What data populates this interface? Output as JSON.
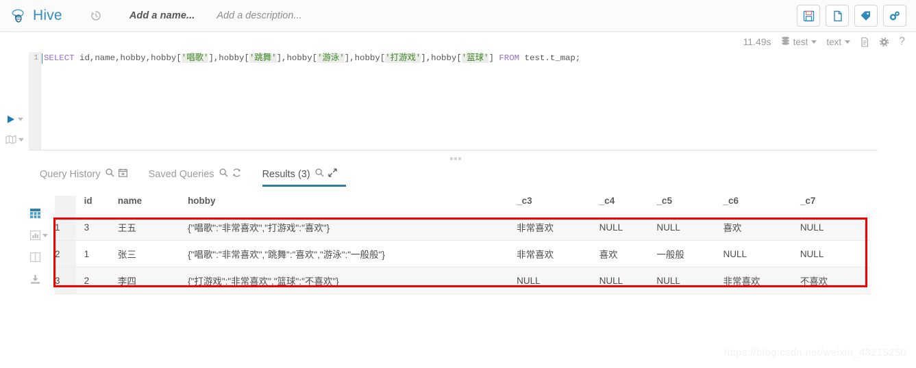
{
  "app": {
    "brand": "Hive",
    "logo_icon": "hive-bee-logo",
    "history_icon": "history-clock-icon",
    "name_placeholder": "Add a name...",
    "description_placeholder": "Add a description...",
    "actions": [
      {
        "name": "save-button",
        "icon": "floppy-disk-icon"
      },
      {
        "name": "new-query-button",
        "icon": "new-file-icon"
      },
      {
        "name": "tag-button",
        "icon": "tag-icon"
      },
      {
        "name": "settings-button",
        "icon": "gears-icon"
      }
    ]
  },
  "editor_meta": {
    "elapsed": "11.49s",
    "database_icon": "database-icon",
    "database": "test",
    "format_label": "text",
    "doc_icon": "document-icon",
    "settings_icon": "gear-icon",
    "help_label": "?"
  },
  "rail": {
    "execute_icon": "play-icon",
    "explain_icon": "map-icon"
  },
  "editor": {
    "line_number": "1",
    "tokens": [
      {
        "t": "SELECT",
        "k": "kw"
      },
      {
        "t": " id,name,hobby,hobby[",
        "k": "punc"
      },
      {
        "t": "'唱歌'",
        "k": "str"
      },
      {
        "t": "],hobby[",
        "k": "punc"
      },
      {
        "t": "'跳舞'",
        "k": "str"
      },
      {
        "t": "],hobby[",
        "k": "punc"
      },
      {
        "t": "'游泳'",
        "k": "str"
      },
      {
        "t": "],hobby[",
        "k": "punc"
      },
      {
        "t": "'打游戏'",
        "k": "str"
      },
      {
        "t": "],hobby[",
        "k": "punc"
      },
      {
        "t": "'篮球'",
        "k": "str"
      },
      {
        "t": "] ",
        "k": "punc"
      },
      {
        "t": "FROM",
        "k": "kw"
      },
      {
        "t": " test.t_map;",
        "k": "punc"
      }
    ]
  },
  "tabs": [
    {
      "label": "Query History",
      "icons": [
        "search-icon",
        "calendar-icon"
      ],
      "active": false
    },
    {
      "label": "Saved Queries",
      "icons": [
        "search-icon",
        "refresh-icon"
      ],
      "active": false
    },
    {
      "label": "Results (3)",
      "icons": [
        "search-icon",
        "expand-icon"
      ],
      "active": true
    }
  ],
  "grid_tools": [
    {
      "name": "grid-view-icon",
      "active": true,
      "caret": false
    },
    {
      "name": "chart-view-icon",
      "active": false,
      "caret": true
    },
    {
      "name": "columns-view-icon",
      "active": false,
      "caret": false
    },
    {
      "name": "download-icon",
      "active": false,
      "caret": false
    }
  ],
  "results": {
    "columns": [
      "",
      "id",
      "name",
      "hobby",
      "_c3",
      "_c4",
      "_c5",
      "_c6",
      "_c7"
    ],
    "rows": [
      {
        "num": "1",
        "id": "3",
        "name": "王五",
        "hobby": "{\"唱歌\":\"非常喜欢\",\"打游戏\":\"喜欢\"}",
        "c3": "非常喜欢",
        "c4": "NULL",
        "c5": "NULL",
        "c6": "喜欢",
        "c7": "NULL"
      },
      {
        "num": "2",
        "id": "1",
        "name": "张三",
        "hobby": "{\"唱歌\":\"非常喜欢\",\"跳舞\":\"喜欢\",\"游泳\":\"一般般\"}",
        "c3": "非常喜欢",
        "c4": "喜欢",
        "c5": "一般般",
        "c6": "NULL",
        "c7": "NULL"
      },
      {
        "num": "3",
        "id": "2",
        "name": "李四",
        "hobby": "{\"打游戏\":\"非常喜欢\",\"篮球\":\"不喜欢\"}",
        "c3": "NULL",
        "c4": "NULL",
        "c5": "NULL",
        "c6": "非常喜欢",
        "c7": "不喜欢"
      }
    ]
  },
  "annotation": {
    "color": "#f50000"
  },
  "watermark": "https://blog.csdn.net/weixin_43215250",
  "colors": {
    "accent": "#2e7fa8",
    "brand": "#338cc1"
  }
}
